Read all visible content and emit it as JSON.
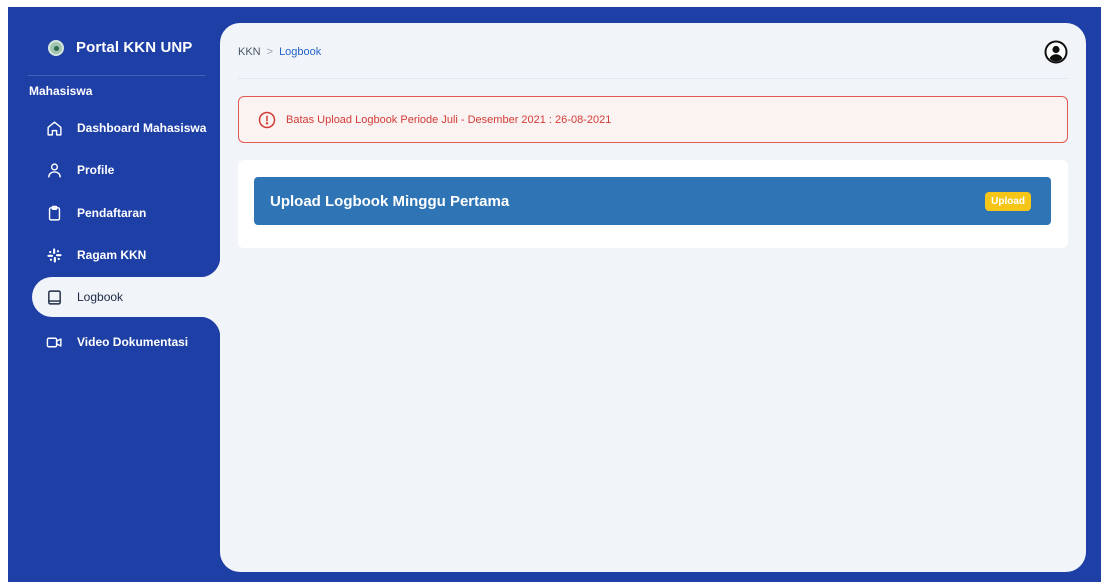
{
  "sidebar": {
    "brand": "Portal KKN UNP",
    "section": "Mahasiswa",
    "items": [
      {
        "label": "Dashboard Mahasiswa",
        "icon": "home-icon"
      },
      {
        "label": "Profile",
        "icon": "user-icon"
      },
      {
        "label": "Pendaftaran",
        "icon": "clipboard-icon"
      },
      {
        "label": "Ragam KKN",
        "icon": "slack-icon"
      },
      {
        "label": "Logbook",
        "icon": "book-icon",
        "active": true
      },
      {
        "label": "Video Dokumentasi",
        "icon": "video-icon"
      }
    ]
  },
  "breadcrumb": {
    "root": "KKN",
    "separator": ">",
    "current": "Logbook"
  },
  "alert": {
    "text": "Batas Upload Logbook Periode Juli - Desember 2021 : 26-08-2021"
  },
  "upload": {
    "title": "Upload Logbook Minggu Pertama",
    "button": "Upload"
  },
  "colors": {
    "sidebar_bg": "#1d3fa6",
    "main_bg": "#f1f5f9",
    "alert": "#d23c36",
    "upload_bar": "#2f74b5",
    "upload_button": "#f5c518"
  }
}
